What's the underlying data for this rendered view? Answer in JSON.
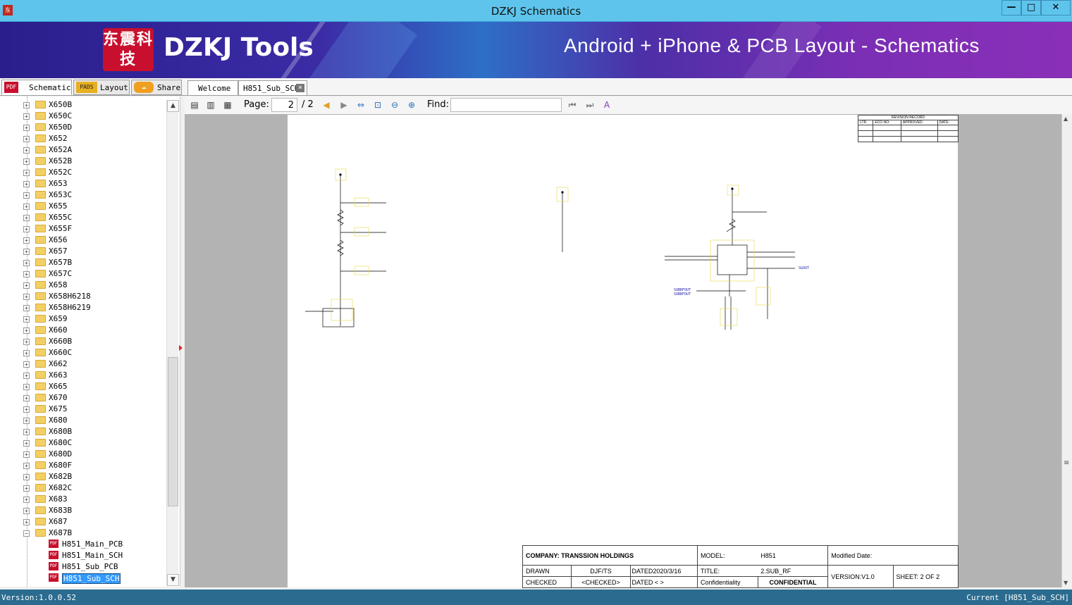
{
  "window": {
    "title": "DZKJ Schematics",
    "minimize": "—",
    "maximize": "□",
    "close": "✕"
  },
  "banner": {
    "logo_text": "东震科技",
    "brand": "DZKJ Tools",
    "tagline": "Android + iPhone & PCB Layout - Schematics"
  },
  "left_tabs": [
    {
      "label": "Schematic",
      "icon": "PDF"
    },
    {
      "label": "Layout",
      "icon": "PADS"
    },
    {
      "label": "Share",
      "icon": "share"
    }
  ],
  "doc_tabs": [
    {
      "label": "Welcome"
    },
    {
      "label": "H851_Sub_SCH"
    }
  ],
  "tree": {
    "folders": [
      "X650B",
      "X650C",
      "X650D",
      "X652",
      "X652A",
      "X652B",
      "X652C",
      "X653",
      "X653C",
      "X655",
      "X655C",
      "X655F",
      "X656",
      "X657",
      "X657B",
      "X657C",
      "X658",
      "X658H6218",
      "X658H6219",
      "X659",
      "X660",
      "X660B",
      "X660C",
      "X662",
      "X663",
      "X665",
      "X670",
      "X675",
      "X680",
      "X680B",
      "X680C",
      "X680D",
      "X680F",
      "X682B",
      "X682C",
      "X683",
      "X683B",
      "X687",
      "X687B"
    ],
    "expanded_folder": "X687B",
    "files": [
      "H851_Main_PCB",
      "H851_Main_SCH",
      "H851_Sub_PCB",
      "H851_Sub_SCH"
    ],
    "selected": "H851_Sub_SCH"
  },
  "toolbar": {
    "page_label": "Page:",
    "page_current": "2",
    "page_total": "/ 2",
    "find_label": "Find:",
    "find_value": ""
  },
  "titleblock": {
    "company": "COMPANY: TRANSSION HOLDINGS",
    "model_label": "MODEL:",
    "model": "H851",
    "modified_label": "Modified Date:",
    "drawn_label": "DRAWN",
    "drawn_by": "DJF/TS",
    "dated_label": "DATED",
    "drawn_date": "2020/3/16",
    "title_label": "TITLE:",
    "title": "2.SUB_RF",
    "checked_label": "CHECKED",
    "checked_by": "<CHECKED>",
    "checked_date": "< >",
    "conf_label": "Confidentiality",
    "conf": "CONFIDENTIAL",
    "version": "VERSION:V1.0",
    "sheet_label": "SHEET:",
    "sheet": "2",
    "of_label": "OF",
    "sheets": "2"
  },
  "revision": {
    "title": "REVISION RECORD",
    "cols": [
      "LTR",
      "ECO NO:",
      "APPROVED:",
      "DATE:"
    ]
  },
  "status": {
    "version": "Version:1.0.0.52",
    "current": "Current [H851_Sub_SCH]"
  }
}
